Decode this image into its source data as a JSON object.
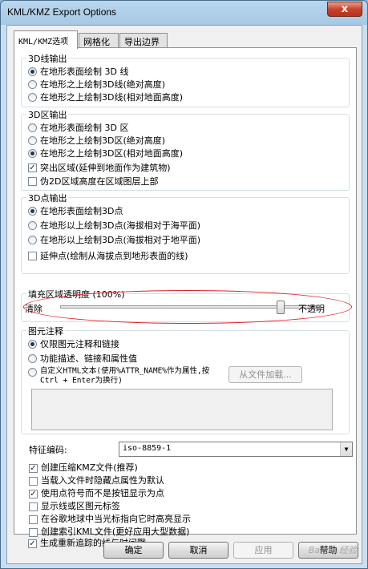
{
  "window": {
    "title": "KML/KMZ Export Options",
    "close": "x"
  },
  "tabs": [
    {
      "label": "KML/KMZ选项"
    },
    {
      "label": "网格化"
    },
    {
      "label": "导出边界"
    }
  ],
  "line3d": {
    "legend": "3D线输出",
    "options": [
      {
        "label": "在地形表面绘制 3D 线",
        "selected": true
      },
      {
        "label": "在地形之上绘制3D线(绝对高度)",
        "selected": false
      },
      {
        "label": "在地形之上绘制3D线(相对地面高度)",
        "selected": false
      }
    ]
  },
  "area3d": {
    "legend": "3D区输出",
    "options": [
      {
        "label": "在地形表面绘制 3D 区",
        "selected": false
      },
      {
        "label": "在地形之上绘制3D区(绝对高度)",
        "selected": false
      },
      {
        "label": "在地形之上绘制3D区(相对地面高度)",
        "selected": true
      }
    ],
    "extrude": {
      "label": "突出区域(延伸到地面作为建筑物)",
      "checked": true
    },
    "pseudo2d": {
      "label": "伪2D区域高度在区域图层上部",
      "checked": false
    }
  },
  "point3d": {
    "legend": "3D点输出",
    "options": [
      {
        "label": "在地形表面绘制3D点",
        "selected": true
      },
      {
        "label": "在地形以上绘制3D点(海拔相对于海平面)",
        "selected": false
      },
      {
        "label": "在地形以上绘制3D点(海拔相对于地平面)",
        "selected": false
      }
    ],
    "extend": {
      "label": "延伸点(绘制从海拔点到地形表面的线)",
      "checked": false
    }
  },
  "fill": {
    "legend": "填充区域透明度 (100%)",
    "left_label": "清除",
    "right_label": "不透明",
    "value_percent": 100
  },
  "annotation": {
    "legend": "图元注释",
    "options": [
      {
        "label": "仅限图元注释和链接",
        "selected": true
      },
      {
        "label": "功能描述、链接和属性值",
        "selected": false
      },
      {
        "label": "自定义HTML文本(使用%ATTR_NAME%作为属性,按Ctrl + Enter为换行)",
        "selected": false
      }
    ],
    "load_button": "从文件加载..."
  },
  "encoding": {
    "label": "特征编码:",
    "value": "iso-8859-1"
  },
  "checks": [
    {
      "label": "创建压缩KMZ文件(推荐)",
      "checked": true
    },
    {
      "label": "当载入文件时隐藏点属性为默认",
      "checked": false
    },
    {
      "label": "使用点符号而不是按钮显示为点",
      "checked": true
    },
    {
      "label": "显示线或区图元标签",
      "checked": false
    },
    {
      "label": "在谷歌地球中当光标指向它时高亮显示",
      "checked": false
    },
    {
      "label": "创建索引KML文件(更好应用大型数据)",
      "checked": false
    },
    {
      "label": "生成重新追踪的线与时间戳",
      "checked": true
    }
  ],
  "buttons": {
    "ok": "确定",
    "cancel": "取消",
    "apply": "应用",
    "help": "帮助"
  },
  "watermark": "Bai du 经验"
}
